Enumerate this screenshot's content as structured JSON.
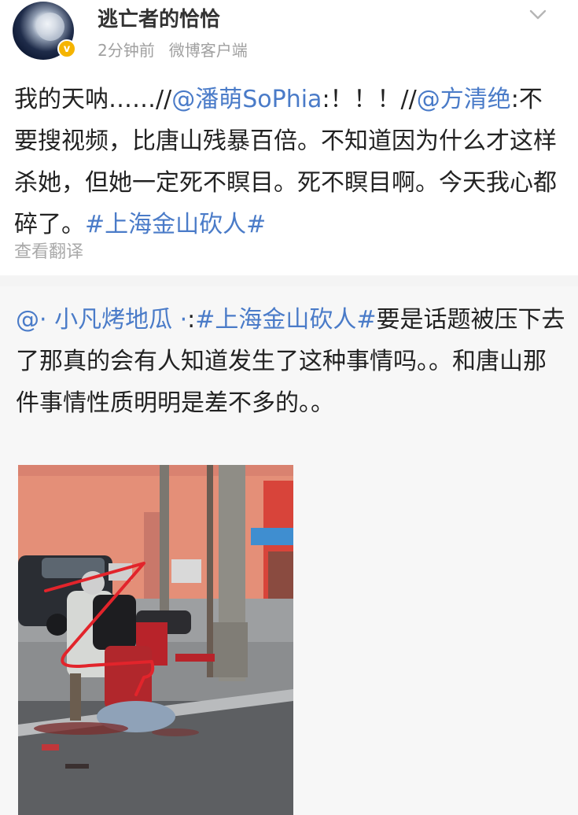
{
  "author": {
    "name": "逃亡者的恰恰",
    "time": "2分钟前",
    "source": "微博客户端",
    "verified_badge": "v",
    "badge_color": "#f5b400"
  },
  "post": {
    "text_1": "我的天呐……//",
    "mention_1": "@潘萌SoPhia",
    "text_2": ":！！！//",
    "mention_2": "@方清绝",
    "text_3": ":不要搜视频，比唐山残暴百倍。不知道因为什么才这样杀她，但她一定死不瞑目。死不瞑目啊。今天我心都碎了。",
    "hashtag": "#上海金山砍人#",
    "translate_label": "查看翻译"
  },
  "repost": {
    "mention": "@· 小凡烤地瓜 ·",
    "text_1": ":",
    "hashtag": "#上海金山砍人#",
    "text_2": "要是话题被压下去了那真的会有人知道发生了这种事情吗。。和唐山那件事情性质明明是差不多的。。"
  },
  "icons": {
    "expand": "chevron-down-icon",
    "link_color": "#4a7bc8"
  }
}
